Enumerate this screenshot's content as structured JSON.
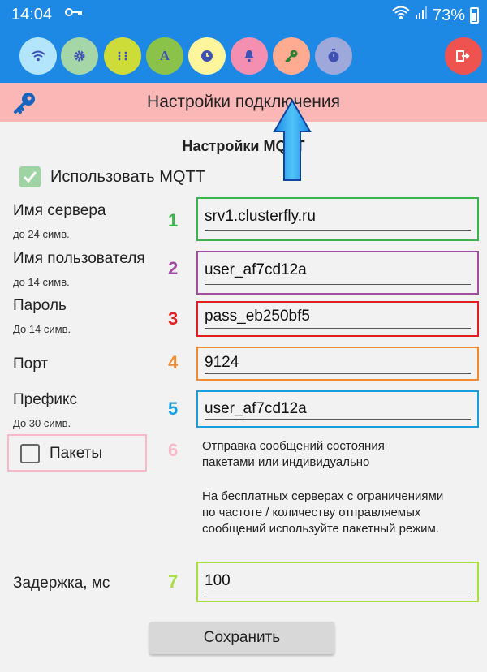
{
  "status_bar": {
    "time": "14:04",
    "battery": "73%"
  },
  "toolbar": {
    "buttons": [
      {
        "name": "wifi",
        "glyph": "",
        "color": "#b3e5fc"
      },
      {
        "name": "settings",
        "glyph": "",
        "color": "#a5d6a7"
      },
      {
        "name": "matrix",
        "glyph": "",
        "color": "#cddc39"
      },
      {
        "name": "font",
        "glyph": "A",
        "color": "#8bc34a"
      },
      {
        "name": "clock",
        "glyph": "",
        "color": "#fff59d"
      },
      {
        "name": "bell",
        "glyph": "",
        "color": "#f48fb1"
      },
      {
        "name": "key",
        "glyph": "",
        "color": "#ffab91"
      },
      {
        "name": "timer",
        "glyph": "",
        "color": "#9fa8da"
      },
      {
        "name": "exit",
        "glyph": "",
        "color": "#ef5350"
      }
    ]
  },
  "header": {
    "title": "Настройки подключения"
  },
  "section_title": "Настройки MQTT",
  "use_mqtt": {
    "label": "Использовать MQTT",
    "checked": true
  },
  "fields": [
    {
      "label": "Имя сервера",
      "hint": "до 24 симв.",
      "number": "1",
      "value": "srv1.clusterfly.ru",
      "color": "#3cb44b"
    },
    {
      "label": "Имя пользователя",
      "hint": "до 14 симв.",
      "number": "2",
      "value": "user_af7cd12a",
      "color": "#a04da3"
    },
    {
      "label": "Пароль",
      "hint": "До 14 симв.",
      "number": "3",
      "value": "pass_eb250bf5",
      "color": "#e02020"
    },
    {
      "label": "Порт",
      "hint": "",
      "number": "4",
      "value": "9124",
      "color": "#f28a2e"
    },
    {
      "label": "Префикс",
      "hint": "До 30 симв.",
      "number": "5",
      "value": "user_af7cd12a",
      "color": "#1a9ede"
    }
  ],
  "packets": {
    "label": "Пакеты",
    "number": "6",
    "color": "#f7b8c8",
    "checked": false,
    "description_1": [
      "Отправка сообщений состояния",
      "пакетами или индивидуально"
    ],
    "description_2": [
      "На бесплатных серверах с ограничениями",
      "по частоте / количеству отправляемых",
      "сообщений используйте пакетный режим."
    ]
  },
  "delay": {
    "label": "Задержка, мс",
    "number": "7",
    "value": "100",
    "color": "#a8e03c"
  },
  "save_button": "Сохранить"
}
